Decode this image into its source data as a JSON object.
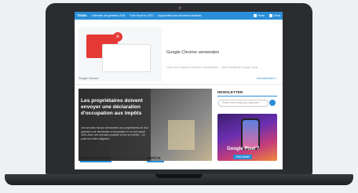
{
  "nav": {
    "brand": "TRUBA",
    "links": [
      "Calendrier des gériatries 2026",
      "Faire l'impôt en 2023",
      "Augmentation des allocations familiales"
    ],
    "home": "Home",
    "contact": "Email"
  },
  "ad": {
    "title": "Google Chrome verwenden",
    "subtitle": "Jetzt noch kostenlos sicherer verschalteter – diese integrierte Google Tools",
    "source": "Google Chrome",
    "more": "Herunterladen >"
  },
  "hero": {
    "title": "Les propriétaires doivent envoyer une déclaration d'occupation aux impôts",
    "text": "Les services fiscaux demandent aux propriétaires de leur adresser une déclaration d'occupation et un tout ayant 30/6. Avec une avenant possible et lien en intérêt... Ce point est cette obligation"
  },
  "categories": [
    "AIDES SOCIALES",
    "IMPÔTS"
  ],
  "newsletter": {
    "title": "NEWSLETTER",
    "placeholder": "Entrer votre email pour s'abonner"
  },
  "google_ad": {
    "product": "Google Pixel 7",
    "cta": "Jetzt kaufen"
  }
}
